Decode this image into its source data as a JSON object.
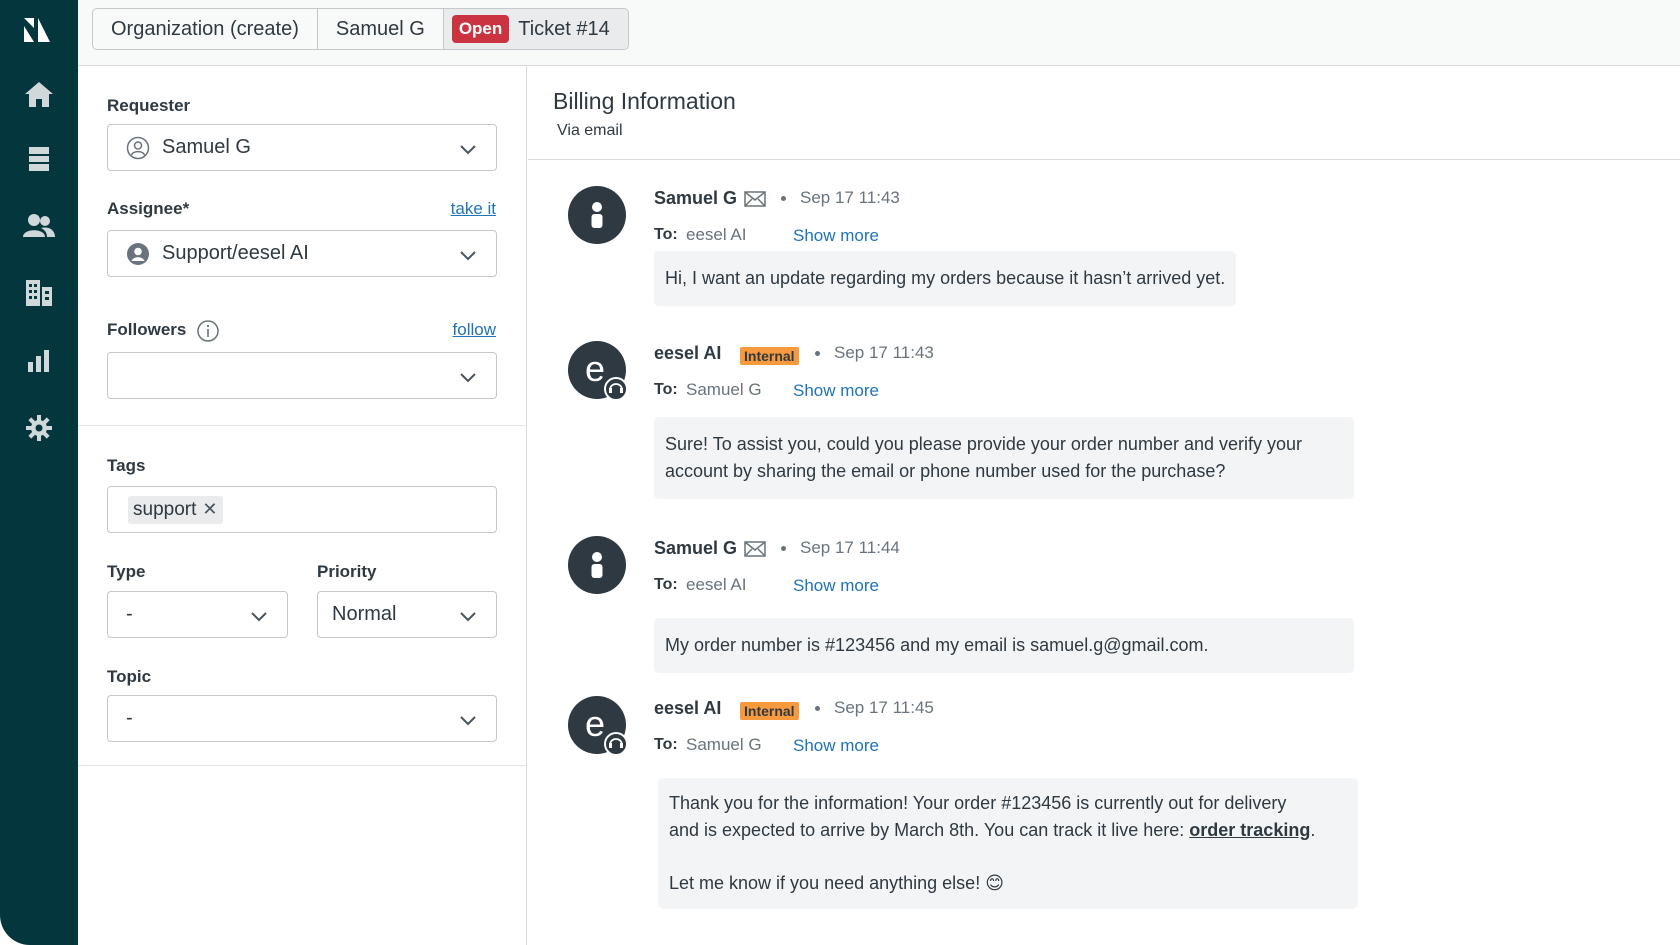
{
  "nav": {
    "items": [
      {
        "icon": "home-icon"
      },
      {
        "icon": "views-icon"
      },
      {
        "icon": "customers-icon"
      },
      {
        "icon": "organizations-icon"
      },
      {
        "icon": "reporting-icon"
      },
      {
        "icon": "admin-gear-icon"
      }
    ]
  },
  "tabs": {
    "organization": "Organization (create)",
    "user": "Samuel G",
    "ticket_status": "Open",
    "ticket": "Ticket #14"
  },
  "properties": {
    "requester_label": "Requester",
    "requester_value": "Samuel G",
    "assignee_label": "Assignee*",
    "assignee_link": "take it",
    "assignee_value": "Support/eesel AI",
    "followers_label": "Followers",
    "followers_link": "follow",
    "followers_value": "",
    "tags_label": "Tags",
    "tags": [
      "support"
    ],
    "type_label": "Type",
    "type_value": "-",
    "priority_label": "Priority",
    "priority_value": "Normal",
    "topic_label": "Topic",
    "topic_value": "-"
  },
  "conversation": {
    "subject": "Billing Information",
    "channel": "Via email",
    "to_label": "To:",
    "show_more": "Show more",
    "messages": [
      {
        "author": "Samuel G",
        "avatar": "user-avatar-icon",
        "badge": "",
        "time": "Sep 17 11:43",
        "to": "eesel AI",
        "body": "Hi, I want an update regarding my orders because it hasn’t arrived yet."
      },
      {
        "author": "eesel AI",
        "avatar": "eesel-avatar-icon",
        "badge": "Internal",
        "time": "Sep 17 11:43",
        "to": "Samuel G",
        "body": "Sure! To assist you, could you please provide your order number and verify your account by sharing the email or phone number used for the purchase?"
      },
      {
        "author": "Samuel G",
        "avatar": "user-avatar-icon",
        "badge": "",
        "time": "Sep 17 11:44",
        "to": "eesel AI",
        "body": "My order number is #123456 and my email is samuel.g@gmail.com."
      },
      {
        "author": "eesel AI",
        "avatar": "eesel-avatar-icon",
        "badge": "Internal",
        "time": "Sep 17 11:45",
        "to": "Samuel G",
        "body_line1": "Thank you for the information! Your order #123456 is currently out for delivery",
        "body_line2_prefix": "and is expected to arrive by March 8th. You can track it live here: ",
        "body_link": "order tracking",
        "body_line2_suffix": ".",
        "body_line3": "Let me know if you need anything else! 😊"
      }
    ]
  },
  "colors": {
    "rail": "#03363d",
    "open_badge": "#cc3340",
    "internal_badge": "#f79a3e",
    "link": "#1f73b7"
  }
}
